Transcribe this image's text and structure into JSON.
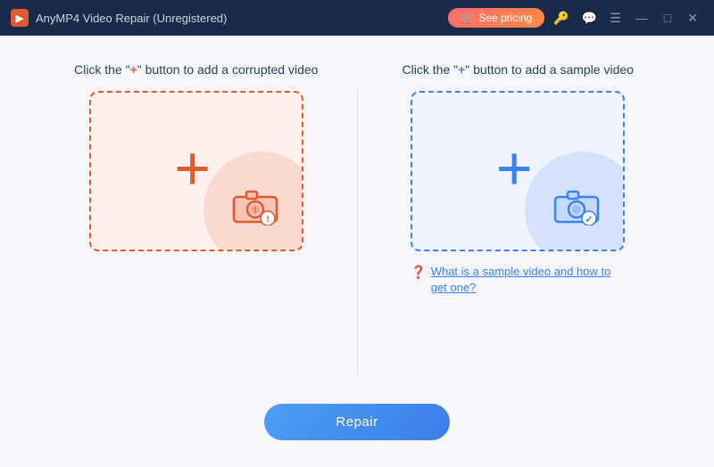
{
  "titleBar": {
    "appName": "AnyMP4 Video Repair (Unregistered)",
    "seePricingLabel": "See pricing",
    "icons": {
      "key": "🔑",
      "chat": "💬",
      "menu": "☰",
      "minimize": "—",
      "maximize": "□",
      "close": "✕"
    }
  },
  "panels": {
    "left": {
      "label_before": "Click the \"",
      "label_plus": "+",
      "label_after": "\" button to add a corrupted video",
      "plusSign": "+",
      "boxAlt": "Add corrupted video"
    },
    "right": {
      "label_before": "Click the \"",
      "label_plus": "+",
      "label_after": "\" button to add a sample video",
      "plusSign": "+",
      "boxAlt": "Add sample video",
      "helpText": "What is a sample video and how to get one?"
    }
  },
  "footer": {
    "repairLabel": "Repair"
  }
}
